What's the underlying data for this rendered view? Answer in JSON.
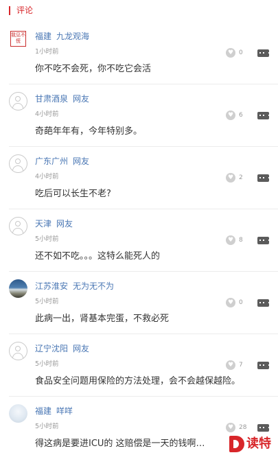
{
  "section": {
    "title": "评论"
  },
  "comments": [
    {
      "location": "福建",
      "name": "九龙观海",
      "time": "1小时前",
      "likes": "0",
      "text": "你不吃不会死，你不吃它会活",
      "avatar": "seal"
    },
    {
      "location": "甘肃酒泉",
      "name": "网友",
      "time": "4小时前",
      "likes": "6",
      "text": "奇葩年年有，今年特别多。",
      "avatar": "default"
    },
    {
      "location": "广东广州",
      "name": "网友",
      "time": "4小时前",
      "likes": "2",
      "text": "吃后可以长生不老?",
      "avatar": "default"
    },
    {
      "location": "天津",
      "name": "网友",
      "time": "5小时前",
      "likes": "8",
      "text": "还不如不吃。。。这特么能死人的",
      "avatar": "default"
    },
    {
      "location": "江苏淮安",
      "name": "无为无不为",
      "time": "5小时前",
      "likes": "0",
      "text": "此病一出，肾基本完蛋，不救必死",
      "avatar": "photo"
    },
    {
      "location": "辽宁沈阳",
      "name": "网友",
      "time": "5小时前",
      "likes": "7",
      "text": "食品安全问题用保险的方法处理，会不会越保越险。",
      "avatar": "default"
    },
    {
      "location": "福建",
      "name": "咩咩",
      "time": "5小时前",
      "likes": "28",
      "text": "得这病是要进ICU的 这赔偿是一天的钱啊…",
      "avatar": "cloud"
    }
  ],
  "seal_text": "我见不慌",
  "logo": {
    "text": "读特"
  },
  "colors": {
    "accent": "#d8262a",
    "username": "#4a77b4"
  }
}
